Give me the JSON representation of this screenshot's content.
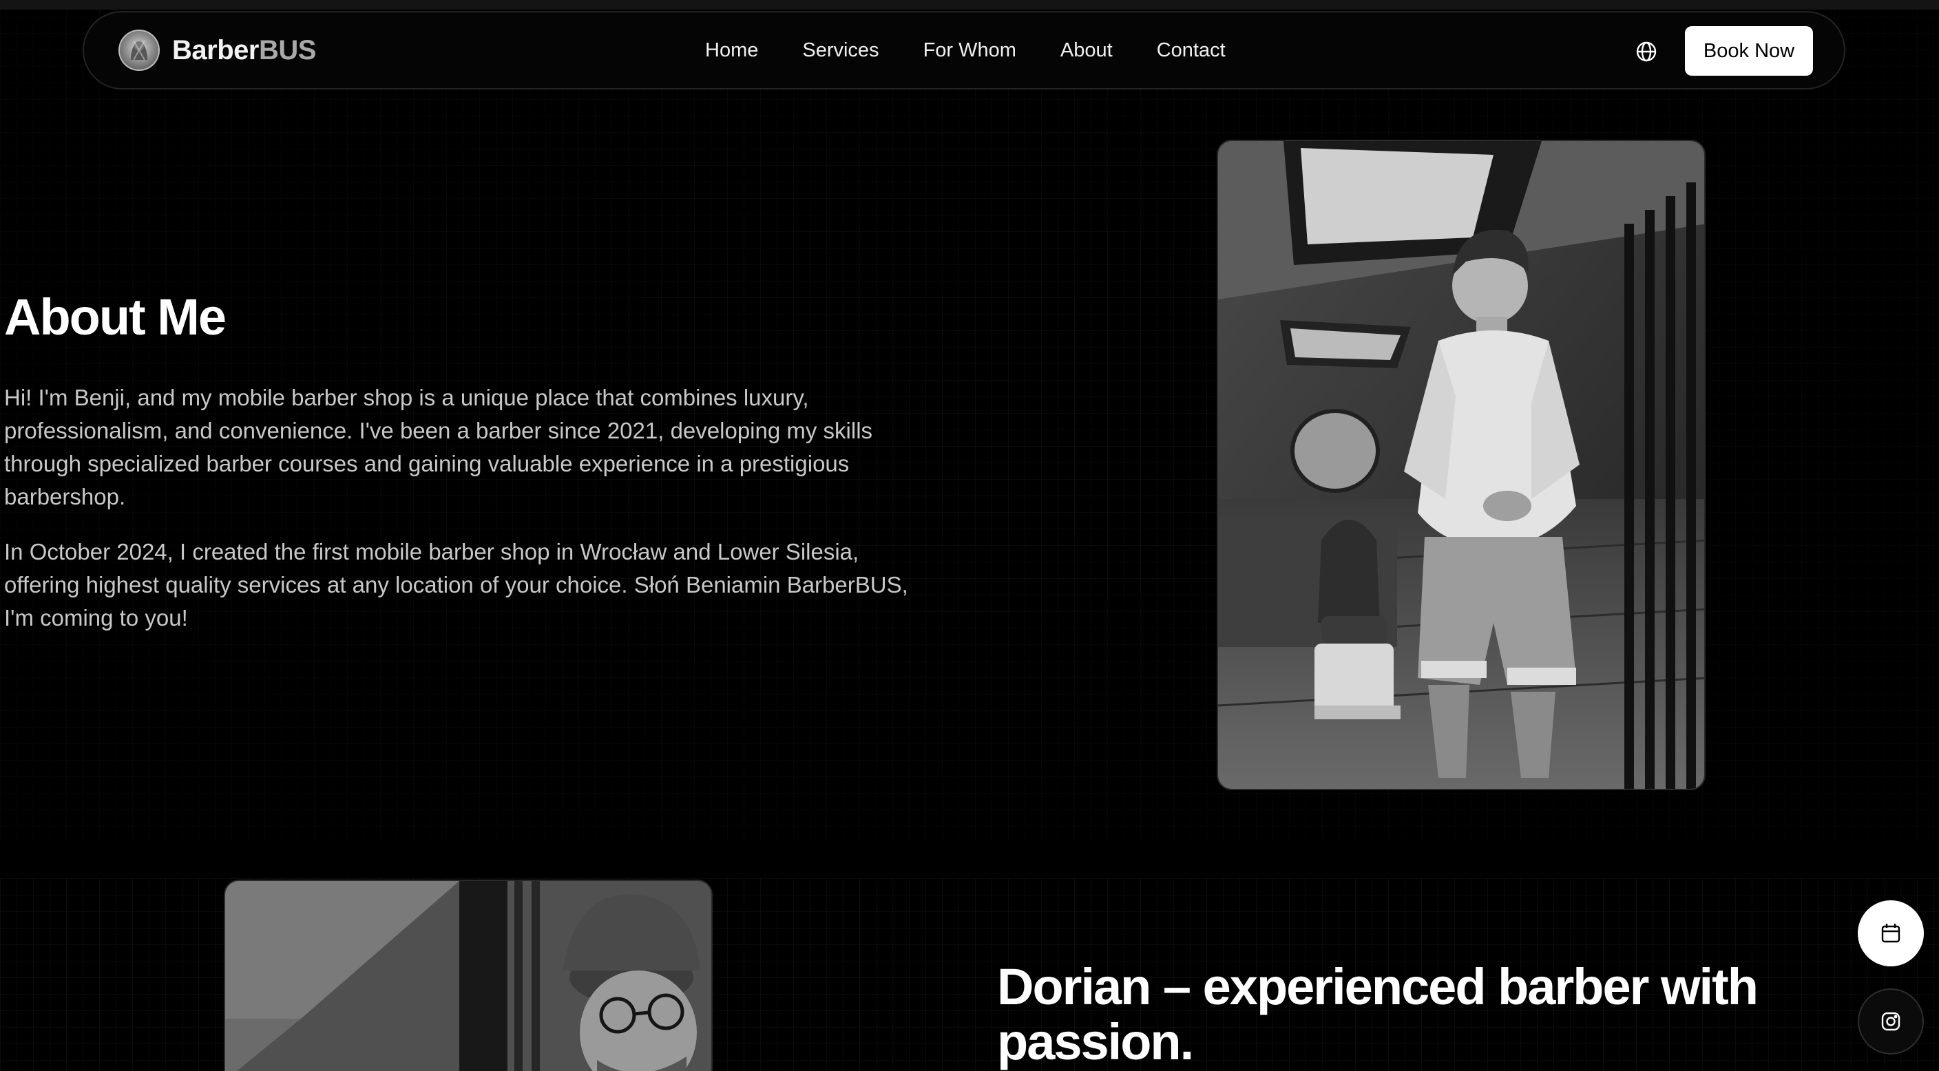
{
  "nav": {
    "brand_main": "Barber",
    "brand_accent": "BUS",
    "menu": [
      {
        "label": "Home"
      },
      {
        "label": "Services"
      },
      {
        "label": "For Whom"
      },
      {
        "label": "About"
      },
      {
        "label": "Contact"
      }
    ],
    "book_label": "Book Now",
    "language_icon": "globe-icon"
  },
  "about": {
    "title": "About Me",
    "paragraph_1": "Hi! I'm Benji, and my mobile barber shop is a unique place that combines luxury, professionalism, and convenience. I've been a barber since 2021, developing my skills through specialized barber courses and gaining valuable experience in a prestigious barbershop.",
    "paragraph_2": "In October 2024, I created the first mobile barber shop in Wrocław and Lower Silesia, offering highest quality services at any location of your choice. Słoń Beniamin BarberBUS, I'm coming to you!"
  },
  "dorian": {
    "title": "Dorian – experienced barber with passion."
  },
  "floating": {
    "calendar_icon": "calendar-icon",
    "instagram_icon": "instagram-icon"
  },
  "colors": {
    "background": "#000000",
    "accent_button": "#ffffff",
    "text_muted": "#c8c8c8"
  }
}
